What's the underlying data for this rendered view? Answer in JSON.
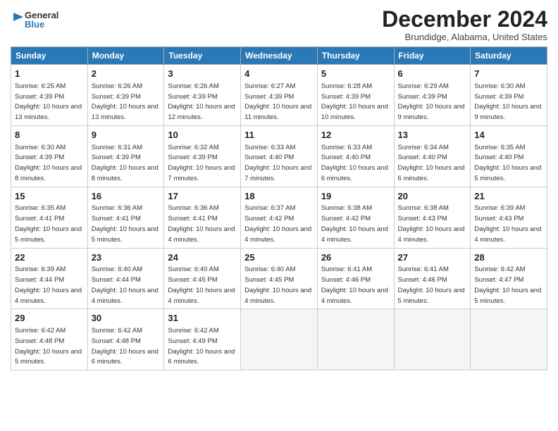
{
  "header": {
    "logo": {
      "general": "General",
      "blue": "Blue"
    },
    "title": "December 2024",
    "subtitle": "Brundidge, Alabama, United States"
  },
  "days_of_week": [
    "Sunday",
    "Monday",
    "Tuesday",
    "Wednesday",
    "Thursday",
    "Friday",
    "Saturday"
  ],
  "weeks": [
    [
      {
        "day": 1,
        "info": "Sunrise: 6:25 AM\nSunset: 4:39 PM\nDaylight: 10 hours and 13 minutes."
      },
      {
        "day": 2,
        "info": "Sunrise: 6:26 AM\nSunset: 4:39 PM\nDaylight: 10 hours and 13 minutes."
      },
      {
        "day": 3,
        "info": "Sunrise: 6:26 AM\nSunset: 4:39 PM\nDaylight: 10 hours and 12 minutes."
      },
      {
        "day": 4,
        "info": "Sunrise: 6:27 AM\nSunset: 4:39 PM\nDaylight: 10 hours and 11 minutes."
      },
      {
        "day": 5,
        "info": "Sunrise: 6:28 AM\nSunset: 4:39 PM\nDaylight: 10 hours and 10 minutes."
      },
      {
        "day": 6,
        "info": "Sunrise: 6:29 AM\nSunset: 4:39 PM\nDaylight: 10 hours and 9 minutes."
      },
      {
        "day": 7,
        "info": "Sunrise: 6:30 AM\nSunset: 4:39 PM\nDaylight: 10 hours and 9 minutes."
      }
    ],
    [
      {
        "day": 8,
        "info": "Sunrise: 6:30 AM\nSunset: 4:39 PM\nDaylight: 10 hours and 8 minutes."
      },
      {
        "day": 9,
        "info": "Sunrise: 6:31 AM\nSunset: 4:39 PM\nDaylight: 10 hours and 8 minutes."
      },
      {
        "day": 10,
        "info": "Sunrise: 6:32 AM\nSunset: 4:39 PM\nDaylight: 10 hours and 7 minutes."
      },
      {
        "day": 11,
        "info": "Sunrise: 6:33 AM\nSunset: 4:40 PM\nDaylight: 10 hours and 7 minutes."
      },
      {
        "day": 12,
        "info": "Sunrise: 6:33 AM\nSunset: 4:40 PM\nDaylight: 10 hours and 6 minutes."
      },
      {
        "day": 13,
        "info": "Sunrise: 6:34 AM\nSunset: 4:40 PM\nDaylight: 10 hours and 6 minutes."
      },
      {
        "day": 14,
        "info": "Sunrise: 6:35 AM\nSunset: 4:40 PM\nDaylight: 10 hours and 5 minutes."
      }
    ],
    [
      {
        "day": 15,
        "info": "Sunrise: 6:35 AM\nSunset: 4:41 PM\nDaylight: 10 hours and 5 minutes."
      },
      {
        "day": 16,
        "info": "Sunrise: 6:36 AM\nSunset: 4:41 PM\nDaylight: 10 hours and 5 minutes."
      },
      {
        "day": 17,
        "info": "Sunrise: 6:36 AM\nSunset: 4:41 PM\nDaylight: 10 hours and 4 minutes."
      },
      {
        "day": 18,
        "info": "Sunrise: 6:37 AM\nSunset: 4:42 PM\nDaylight: 10 hours and 4 minutes."
      },
      {
        "day": 19,
        "info": "Sunrise: 6:38 AM\nSunset: 4:42 PM\nDaylight: 10 hours and 4 minutes."
      },
      {
        "day": 20,
        "info": "Sunrise: 6:38 AM\nSunset: 4:43 PM\nDaylight: 10 hours and 4 minutes."
      },
      {
        "day": 21,
        "info": "Sunrise: 6:39 AM\nSunset: 4:43 PM\nDaylight: 10 hours and 4 minutes."
      }
    ],
    [
      {
        "day": 22,
        "info": "Sunrise: 6:39 AM\nSunset: 4:44 PM\nDaylight: 10 hours and 4 minutes."
      },
      {
        "day": 23,
        "info": "Sunrise: 6:40 AM\nSunset: 4:44 PM\nDaylight: 10 hours and 4 minutes."
      },
      {
        "day": 24,
        "info": "Sunrise: 6:40 AM\nSunset: 4:45 PM\nDaylight: 10 hours and 4 minutes."
      },
      {
        "day": 25,
        "info": "Sunrise: 6:40 AM\nSunset: 4:45 PM\nDaylight: 10 hours and 4 minutes."
      },
      {
        "day": 26,
        "info": "Sunrise: 6:41 AM\nSunset: 4:46 PM\nDaylight: 10 hours and 4 minutes."
      },
      {
        "day": 27,
        "info": "Sunrise: 6:41 AM\nSunset: 4:46 PM\nDaylight: 10 hours and 5 minutes."
      },
      {
        "day": 28,
        "info": "Sunrise: 6:42 AM\nSunset: 4:47 PM\nDaylight: 10 hours and 5 minutes."
      }
    ],
    [
      {
        "day": 29,
        "info": "Sunrise: 6:42 AM\nSunset: 4:48 PM\nDaylight: 10 hours and 5 minutes."
      },
      {
        "day": 30,
        "info": "Sunrise: 6:42 AM\nSunset: 4:48 PM\nDaylight: 10 hours and 6 minutes."
      },
      {
        "day": 31,
        "info": "Sunrise: 6:42 AM\nSunset: 4:49 PM\nDaylight: 10 hours and 6 minutes."
      },
      null,
      null,
      null,
      null
    ]
  ]
}
